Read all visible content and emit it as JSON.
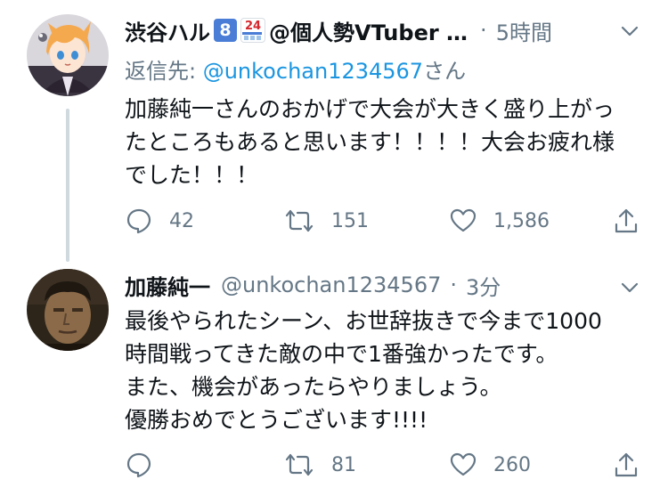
{
  "tweet1": {
    "display_name": "渋谷ハル",
    "badge_number": "8",
    "badge_store_text": "24",
    "handle_suffix": "@個人勢VTuber …",
    "dot": "·",
    "time": "5時間",
    "reply_to_label": "返信先: ",
    "reply_to_handle": "@unkochan1234567",
    "reply_to_suffix": "さん",
    "text_lines": [
      "加藤純一さんのおかげで大会が大きく盛り上がっ",
      "たところもあると思います！！！！大会お疲れ様",
      "でした！！！"
    ],
    "reply_count": "42",
    "retweet_count": "151",
    "like_count": "1,586"
  },
  "tweet2": {
    "display_name": "加藤純一",
    "handle": "@unkochan1234567",
    "dot": "·",
    "time": "3分",
    "text_lines": [
      "最後やられたシーン、お世辞抜きで今まで1000",
      "時間戦ってきた敵の中で1番強かったです。",
      "また、機会があったらやりましょう。",
      "優勝おめでとうございます!!!!"
    ],
    "reply_count": "",
    "retweet_count": "81",
    "like_count": "260"
  },
  "colors": {
    "text": "#0f1419",
    "secondary": "#657786",
    "link": "#1b95e0",
    "thread_line": "#cfd9de",
    "badge_blue": "#4a7dd6"
  }
}
